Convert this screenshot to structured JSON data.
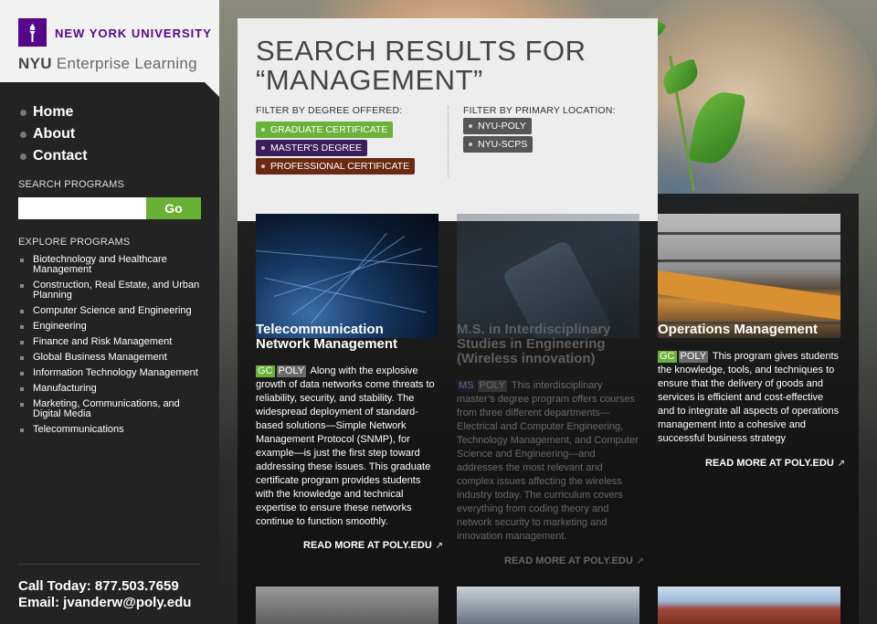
{
  "brand": {
    "university": "NEW YORK UNIVERSITY",
    "nyu": "NYU",
    "product": "Enterprise Learning"
  },
  "nav": [
    "Home",
    "About",
    "Contact"
  ],
  "search": {
    "heading": "SEARCH PROGRAMS",
    "placeholder": "",
    "button": "Go"
  },
  "explore": {
    "heading": "EXPLORE PROGRAMS",
    "items": [
      "Biotechnology and Healthcare Management",
      "Construction, Real Estate, and Urban Planning",
      "Computer Science and Engineering",
      "Engineering",
      "Finance and Risk Management",
      "Global Business Management",
      "Information Technology Management",
      "Manufacturing",
      "Marketing, Communications, and Digital Media",
      "Telecommunications"
    ]
  },
  "contact": {
    "phone": "Call Today: 877.503.7659",
    "email": "Email: jvanderw@poly.edu"
  },
  "header": {
    "title": "SEARCH RESULTS FOR “MANAGEMENT”",
    "degree_filter": {
      "label": "FILTER BY DEGREE OFFERED:",
      "tags": [
        {
          "label": "GRADUATE CERTIFICATE",
          "color": "#6ab23a"
        },
        {
          "label": "MASTER'S DEGREE",
          "color": "#3a1f5c"
        },
        {
          "label": "PROFESSIONAL CERTIFICATE",
          "color": "#6a2a12"
        }
      ]
    },
    "location_filter": {
      "label": "FILTER BY PRIMARY LOCATION:",
      "tags": [
        {
          "label": "NYU-POLY",
          "color": "#555555"
        },
        {
          "label": "NYU-SCPS",
          "color": "#555555"
        }
      ]
    }
  },
  "results": [
    {
      "title": "Telecommunication Network Management",
      "badges": [
        {
          "label": "GC",
          "color": "#6ab23a"
        },
        {
          "label": "POLY",
          "color": "#6a6a6a"
        }
      ],
      "body": "Along with the explosive growth of data networks come threats to reliability, security, and stability. The widespread deployment of standard-based solutions—Simple Network Management Protocol (SNMP), for example—is just the first step toward addressing these issues. This graduate certificate program provides students with the knowledge and technical expertise to ensure these networks continue to function smoothly.",
      "read_more": "READ MORE AT POLY.EDU",
      "thumb": "network-globe-image"
    },
    {
      "title": "M.S. in Interdisciplinary Studies in Engineering (Wireless innovation)",
      "badges": [
        {
          "label": "MS",
          "color": "#3a1f5c"
        },
        {
          "label": "POLY",
          "color": "#6a6a6a"
        }
      ],
      "body": "This interdisciplinary master’s degree program offers courses from three different departments—Electrical and Computer Engineering, Technology Management, and Computer Science and Engineering—and addresses the most relevant and complex issues affecting the wireless industry today. The curriculum covers everything from coding theory and network security to marketing and innovation management.",
      "read_more": "READ MORE AT POLY.EDU",
      "thumb": "hand-phone-image"
    },
    {
      "title": "Operations Management",
      "badges": [
        {
          "label": "GC",
          "color": "#6ab23a"
        },
        {
          "label": "POLY",
          "color": "#6a6a6a"
        }
      ],
      "body": "This program gives students the knowledge, tools, and techniques to ensure that the delivery of goods and services is efficient and cost-effective and to integrate all aspects of operations management into a cohesive and successful business strategy",
      "read_more": "READ MORE AT POLY.EDU",
      "thumb": "stock-ticker-building-image"
    }
  ],
  "arrow_glyph": "↗"
}
